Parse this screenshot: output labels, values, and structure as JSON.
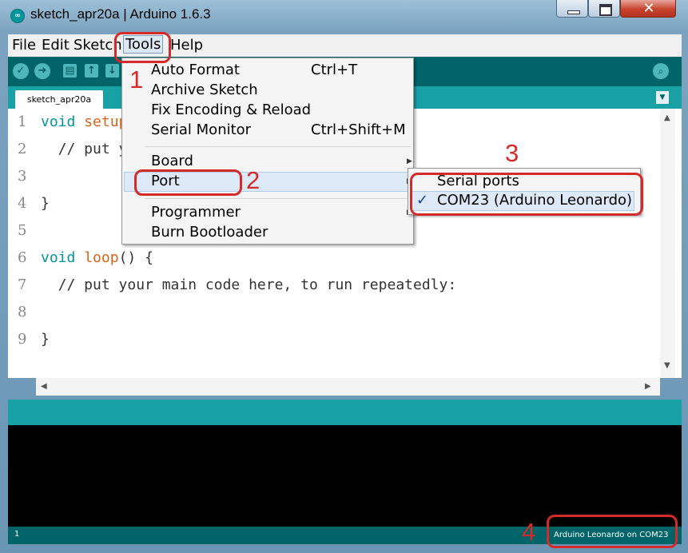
{
  "window": {
    "title": "sketch_apr20a | Arduino 1.6.3",
    "close_glyph": "✕"
  },
  "menubar": {
    "file": "File",
    "edit": "Edit",
    "sketch": "Sketch",
    "tools": "Tools",
    "help": "Help"
  },
  "tabs": {
    "active": "sketch_apr20a"
  },
  "editor": {
    "line_numbers": [
      "1",
      "2",
      "3",
      "4",
      "5",
      "6",
      "7",
      "8",
      "9"
    ],
    "lines": [
      {
        "kw": "void",
        "fn": "setup",
        "rest": ""
      },
      {
        "text": "  // put y"
      },
      {
        "text": ""
      },
      {
        "text": "}"
      },
      {
        "text": ""
      },
      {
        "kw": "void",
        "fn": "loop",
        "rest": "() {"
      },
      {
        "text": "  // put your main code here, to run repeatedly:"
      },
      {
        "text": ""
      },
      {
        "text": "}"
      }
    ]
  },
  "tools_menu": {
    "auto_format": "Auto Format",
    "auto_format_shortcut": "Ctrl+T",
    "archive_sketch": "Archive Sketch",
    "fix_encoding": "Fix Encoding & Reload",
    "serial_monitor": "Serial Monitor",
    "serial_monitor_shortcut": "Ctrl+Shift+M",
    "board": "Board",
    "port": "Port",
    "programmer": "Programmer",
    "burn_bootloader": "Burn Bootloader"
  },
  "port_submenu": {
    "header": "Serial ports",
    "selected_port": "COM23 (Arduino Leonardo)",
    "check": "✓"
  },
  "status": {
    "line": "1",
    "board": "Arduino Leonardo on COM23"
  },
  "annotations": {
    "n1": "1",
    "n2": "2",
    "n3": "3",
    "n4": "4"
  }
}
